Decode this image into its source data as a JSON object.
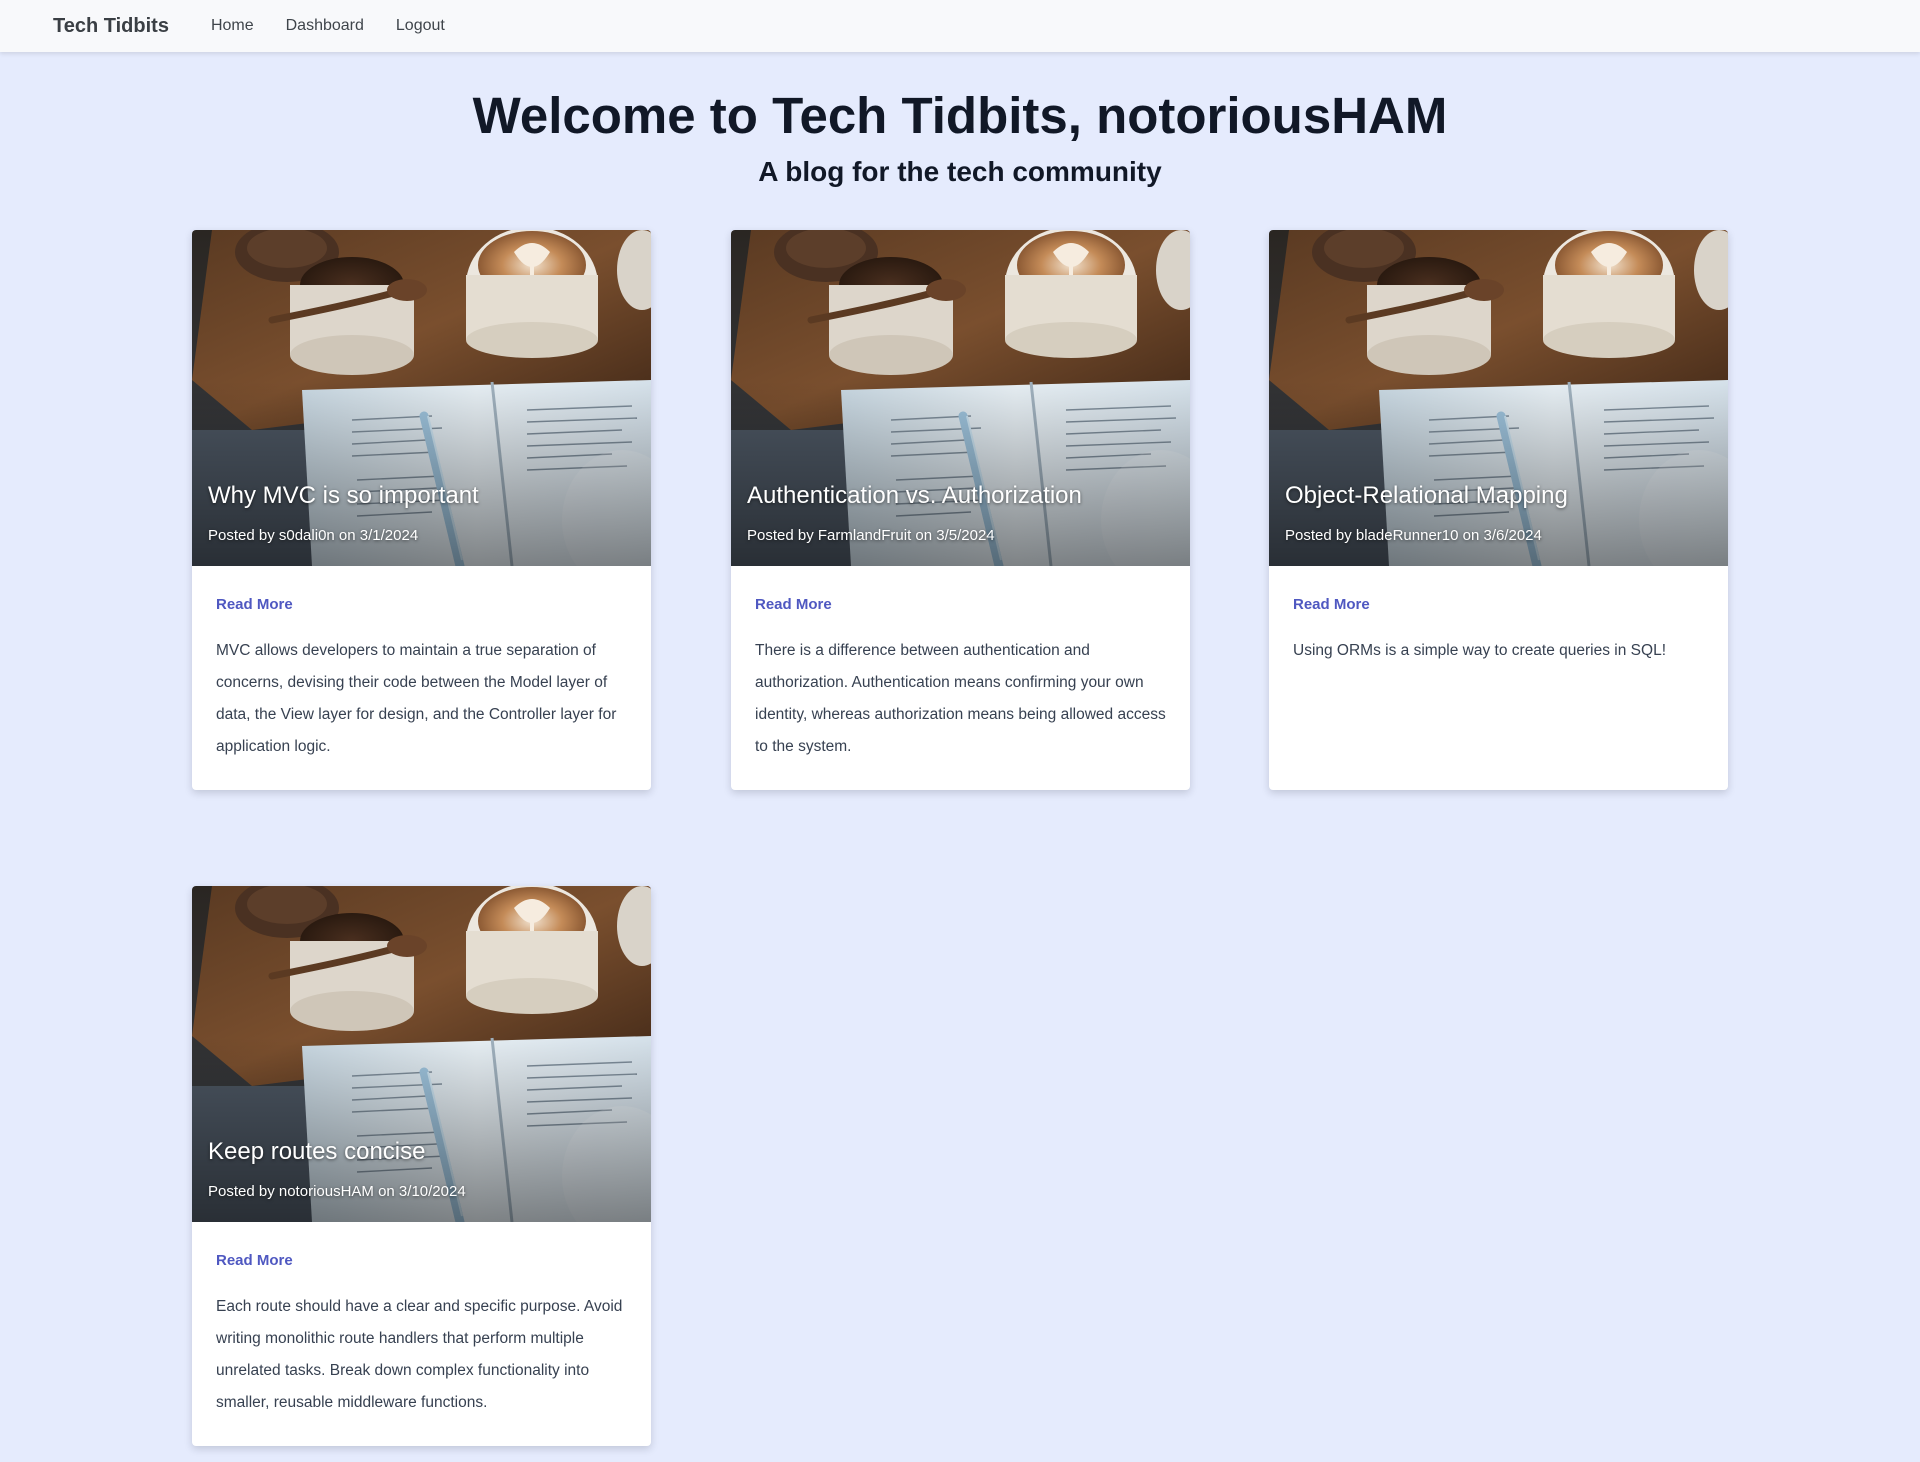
{
  "nav": {
    "brand": "Tech Tidbits",
    "links": [
      "Home",
      "Dashboard",
      "Logout"
    ]
  },
  "hero": {
    "title": "Welcome to Tech Tidbits, notoriousHAM",
    "subtitle": "A blog for the tech community"
  },
  "posts": [
    {
      "title": "Why MVC is so important",
      "meta": "Posted by s0dali0n on 3/1/2024",
      "read_more": "Read More",
      "excerpt": "MVC allows developers to maintain a true separation of concerns, devising their code between the Model layer of data, the View layer for design, and the Controller layer for application logic."
    },
    {
      "title": "Authentication vs. Authorization",
      "meta": "Posted by FarmlandFruit on 3/5/2024",
      "read_more": "Read More",
      "excerpt": "There is a difference between authentication and authorization. Authentication means confirming your own identity, whereas authorization means being allowed access to the system."
    },
    {
      "title": "Object-Relational Mapping",
      "meta": "Posted by bladeRunner10 on 3/6/2024",
      "read_more": "Read More",
      "excerpt": "Using ORMs is a simple way to create queries in SQL!"
    },
    {
      "title": "Keep routes concise",
      "meta": "Posted by notoriousHAM on 3/10/2024",
      "read_more": "Read More",
      "excerpt": "Each route should have a clear and specific purpose. Avoid writing monolithic route handlers that perform multiple unrelated tasks. Break down complex functionality into smaller, reusable middleware functions."
    }
  ],
  "colors": {
    "page_background": "#e5ebfd",
    "navbar_background": "#f8f9fb",
    "link_accent": "#4f58c1",
    "heading_text": "#111827"
  }
}
